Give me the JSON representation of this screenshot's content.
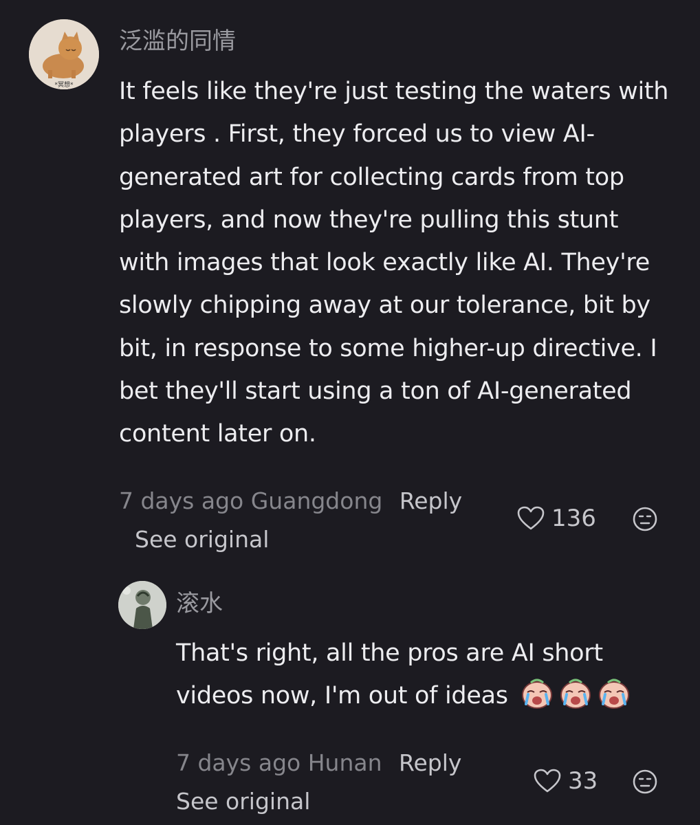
{
  "comments": [
    {
      "username": "泛滥的同情",
      "avatar_label": "*冥想*",
      "body": "It feels like they're just testing the waters with players . First, they forced us to view AI-generated art for collecting cards from top players, and now they're pulling this stunt with images that look exactly like AI. They're slowly chipping away at our tolerance, bit by bit, in response to some higher-up directive. I bet they'll start using a ton of AI-generated content later on.",
      "time": "7 days ago",
      "location": "Guangdong",
      "reply_label": "Reply",
      "see_original_label": "See original",
      "likes": "136",
      "icons": {
        "like": "heart-outline-icon",
        "dislike": "neutral-face-icon"
      }
    },
    {
      "username": "滚水",
      "body": "That's right, all the pros are AI short videos now, I'm out of ideas",
      "emoji": [
        "crying-face-emoji",
        "crying-face-emoji",
        "crying-face-emoji"
      ],
      "time": "7 days ago",
      "location": "Hunan",
      "reply_label": "Reply",
      "see_original_label": "See original",
      "likes": "33",
      "icons": {
        "like": "heart-outline-icon",
        "dislike": "neutral-face-icon"
      }
    }
  ],
  "colors": {
    "background": "#1c1b21",
    "text_primary": "#ededf0",
    "text_secondary": "#86868c",
    "text_action": "#c6c6cb"
  }
}
